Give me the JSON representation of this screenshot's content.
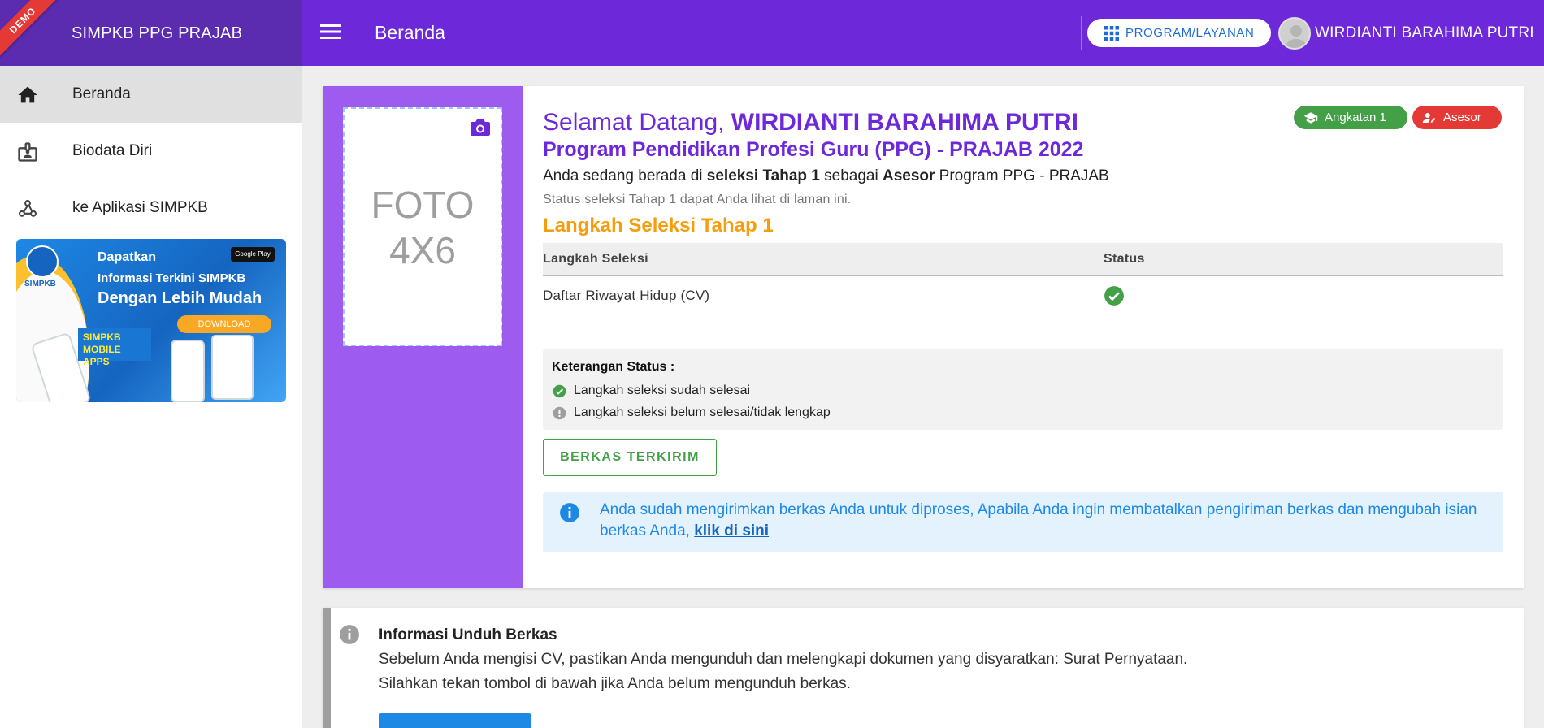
{
  "sidebar": {
    "brand": "SIMPKB PPG PRAJAB",
    "ribbon": "DEMO",
    "items": [
      {
        "label": "Beranda"
      },
      {
        "label": "Biodata Diri"
      },
      {
        "label": "ke Aplikasi SIMPKB"
      }
    ],
    "banner": {
      "logo_text": "SIMPKB",
      "line1": "Dapatkan",
      "line2": "Informasi Terkini SIMPKB",
      "line3": "Dengan Lebih Mudah",
      "store": "Google Play",
      "download": "DOWNLOAD",
      "mobile": "SIMPKB MOBILE APPS"
    }
  },
  "topbar": {
    "title": "Beranda",
    "program_button": "PROGRAM/LAYANAN",
    "user_name": "WIRDIANTI BARAHIMA PUTRI"
  },
  "welcome": {
    "photo_placeholder_1": "FOTO",
    "photo_placeholder_2": "4X6",
    "greeting": "Selamat Datang, ",
    "name": "WIRDIANTI BARAHIMA PUTRI",
    "program": "Program Pendidikan Profesi Guru (PPG) - PRAJAB 2022",
    "desc_1": "Anda sedang berada di ",
    "desc_bold_1": "seleksi Tahap 1",
    "desc_2": " sebagai ",
    "desc_bold_2": "Asesor",
    "desc_3": " Program PPG - PRAJAB",
    "status_note": "Status seleksi Tahap 1 dapat Anda lihat di laman ini.",
    "badges": {
      "angkatan": "Angkatan 1",
      "role": "Asesor"
    },
    "section_title": "Langkah Seleksi Tahap 1",
    "table": {
      "headers": [
        "Langkah Seleksi",
        "Status"
      ],
      "rows": [
        {
          "step": "Daftar Riwayat Hidup (CV)",
          "status": "done"
        }
      ]
    },
    "legend": {
      "title": "Keterangan Status :",
      "done": "Langkah seleksi sudah selesai",
      "pending": "Langkah seleksi belum selesai/tidak lengkap"
    },
    "submit_button": "BERKAS TERKIRIM",
    "alert_text": "Anda sudah mengirimkan berkas Anda untuk diproses, Apabila Anda ingin membatalkan pengiriman berkas dan mengubah isian berkas Anda, ",
    "alert_link": "klik di sini"
  },
  "info_card": {
    "title": "Informasi Unduh Berkas",
    "line1": "Sebelum Anda mengisi CV, pastikan Anda mengunduh dan melengkapi dokumen yang disyaratkan: Surat Pernyataan.",
    "line2": "Silahkan tekan tombol di bawah jika Anda belum mengunduh berkas."
  },
  "colors": {
    "primary": "#6d28d9",
    "photo_panel": "#9e5bf0",
    "success": "#43a047",
    "danger": "#e53935",
    "accent": "#f59e0b",
    "info": "#1e88e5"
  }
}
